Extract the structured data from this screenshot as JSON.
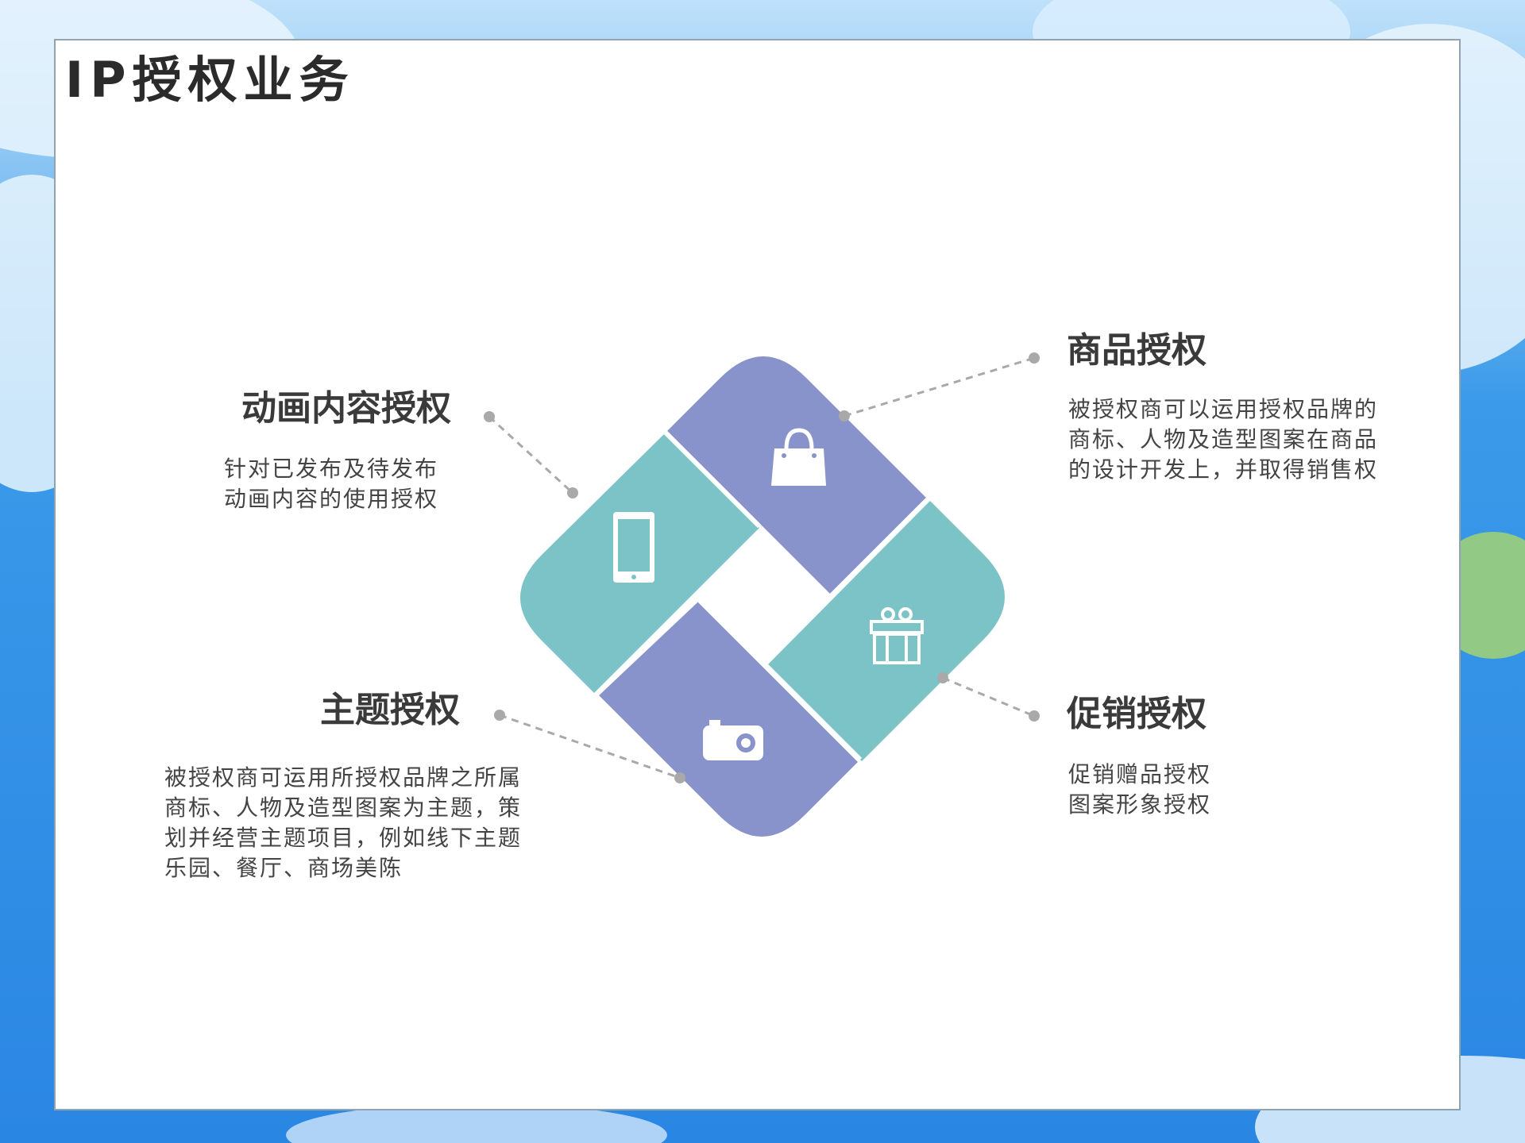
{
  "title": "IP授权业务",
  "colors": {
    "purple": "#8892cb",
    "teal": "#7cc3c8",
    "connector": "#a9a9a9",
    "heading": "#3a3a3a",
    "body_text": "#444444",
    "background_blue": "#2f8fe6"
  },
  "items": [
    {
      "key": "animation",
      "heading": "动画内容授权",
      "lines": [
        "针对已发布及待发布",
        "动画内容的使用授权"
      ],
      "icon": "phone-icon"
    },
    {
      "key": "product",
      "heading": "商品授权",
      "lines": [
        "被授权商可以运用授权品牌的",
        "商标、人物及造型图案在商品",
        "的设计开发上，并取得销售权"
      ],
      "icon": "shopping-bag-icon"
    },
    {
      "key": "theme",
      "heading": "主题授权",
      "lines": [
        "被授权商可运用所授权品牌之所属",
        "商标、人物及造型图案为主题，策",
        "划并经营主题项目，例如线下主题",
        "乐园、餐厅、商场美陈"
      ],
      "icon": "camera-icon"
    },
    {
      "key": "promotion",
      "heading": "促销授权",
      "lines": [
        "促销赠品授权",
        "图案形象授权"
      ],
      "icon": "gift-icon"
    }
  ]
}
